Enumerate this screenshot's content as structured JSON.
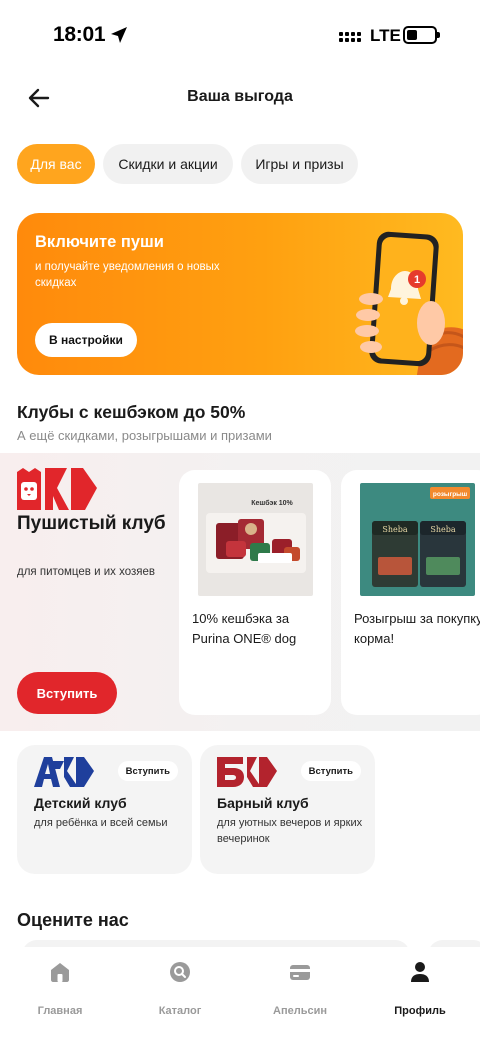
{
  "status_bar": {
    "time": "18:01",
    "network": "LTE"
  },
  "header": {
    "title": "Ваша выгода"
  },
  "tabs": [
    {
      "label": "Для вас",
      "active": true
    },
    {
      "label": "Скидки и акции",
      "active": false
    },
    {
      "label": "Игры и призы",
      "active": false
    }
  ],
  "push_banner": {
    "title": "Включите пуши",
    "subtitle": "и получайте уведомления о новых скидках",
    "button": "В настройки",
    "badge_count": "1"
  },
  "clubs_section": {
    "title": "Клубы с кешбэком до 50%",
    "subtitle": "А ещё скидками, розыгрышами и призами"
  },
  "fluffy_club": {
    "name": "Пушистый клуб",
    "description": "для питомцев и их хозяев",
    "join_button": "Вступить",
    "offers": [
      {
        "text": "10% кешбэка за Purina ONE® dog",
        "image_caption": "Кешбэк 10%"
      },
      {
        "text": "Розыгрыш за покупку корма!",
        "image_caption": "розыгрыш"
      }
    ]
  },
  "small_clubs": [
    {
      "name": "Детский клуб",
      "description": "для ребёнка и всей семьи",
      "join": "Вступить"
    },
    {
      "name": "Барный клуб",
      "description": "для уютных вечеров и ярких вечеринок",
      "join": "Вступить"
    }
  ],
  "rate_us": {
    "title": "Оцените нас"
  },
  "bottom_nav": [
    {
      "label": "Главная",
      "icon": "home-icon",
      "active": false
    },
    {
      "label": "Каталог",
      "icon": "catalog-search-icon",
      "active": false
    },
    {
      "label": "Апельсин",
      "icon": "card-icon",
      "active": false
    },
    {
      "label": "Профиль",
      "icon": "profile-icon",
      "active": true
    }
  ],
  "colors": {
    "accent_orange": "#ffa51e",
    "banner_orange": "#ff8a0c",
    "club_red": "#e1262b",
    "kids_blue": "#1f3f9c",
    "bar_red": "#b3232d"
  }
}
